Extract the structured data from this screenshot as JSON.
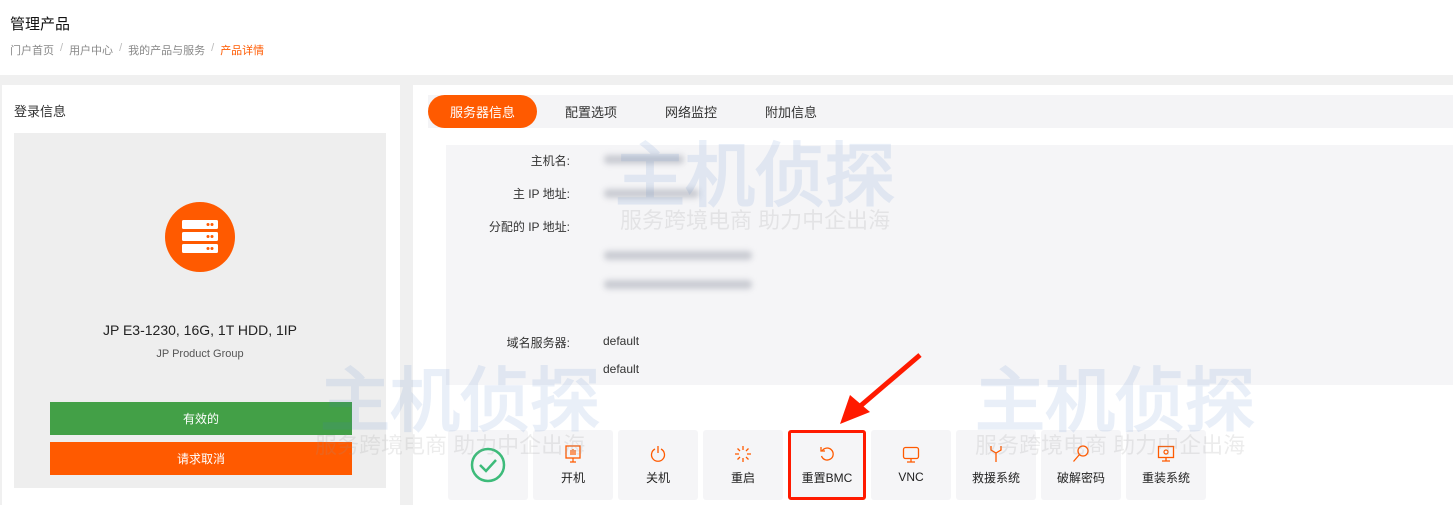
{
  "header": {
    "title": "管理产品",
    "breadcrumb": [
      "门户首页",
      "用户中心",
      "我的产品与服务",
      "产品详情"
    ]
  },
  "left": {
    "title": "登录信息",
    "product_name": "JP E3-1230, 16G, 1T HDD, 1IP",
    "product_group": "JP Product Group",
    "status_button": "有效的",
    "cancel_button": "请求取消"
  },
  "tabs": [
    {
      "label": "服务器信息",
      "active": true
    },
    {
      "label": "配置选项"
    },
    {
      "label": "网络监控"
    },
    {
      "label": "附加信息"
    }
  ],
  "info": {
    "hostname_label": "主机名:",
    "main_ip_label": "主 IP 地址:",
    "assigned_ip_label": "分配的 IP 地址:",
    "nameserver_label": "域名服务器:",
    "nameservers": [
      "default",
      "default"
    ]
  },
  "actions": [
    {
      "label": "",
      "icon": "check-circle-icon"
    },
    {
      "label": "开机",
      "icon": "power-on-icon"
    },
    {
      "label": "关机",
      "icon": "power-off-icon"
    },
    {
      "label": "重启",
      "icon": "reboot-icon"
    },
    {
      "label": "重置BMC",
      "icon": "reset-icon"
    },
    {
      "label": "VNC",
      "icon": "monitor-icon"
    },
    {
      "label": "救援系统",
      "icon": "rescue-icon"
    },
    {
      "label": "破解密码",
      "icon": "key-icon"
    },
    {
      "label": "重装系统",
      "icon": "reinstall-icon"
    }
  ],
  "watermark": {
    "brand": "主机侦探",
    "slogan": "服务跨境电商 助力中企出海"
  },
  "colors": {
    "accent": "#ff5a00",
    "success": "#43a047",
    "highlight": "#ff1a00"
  }
}
